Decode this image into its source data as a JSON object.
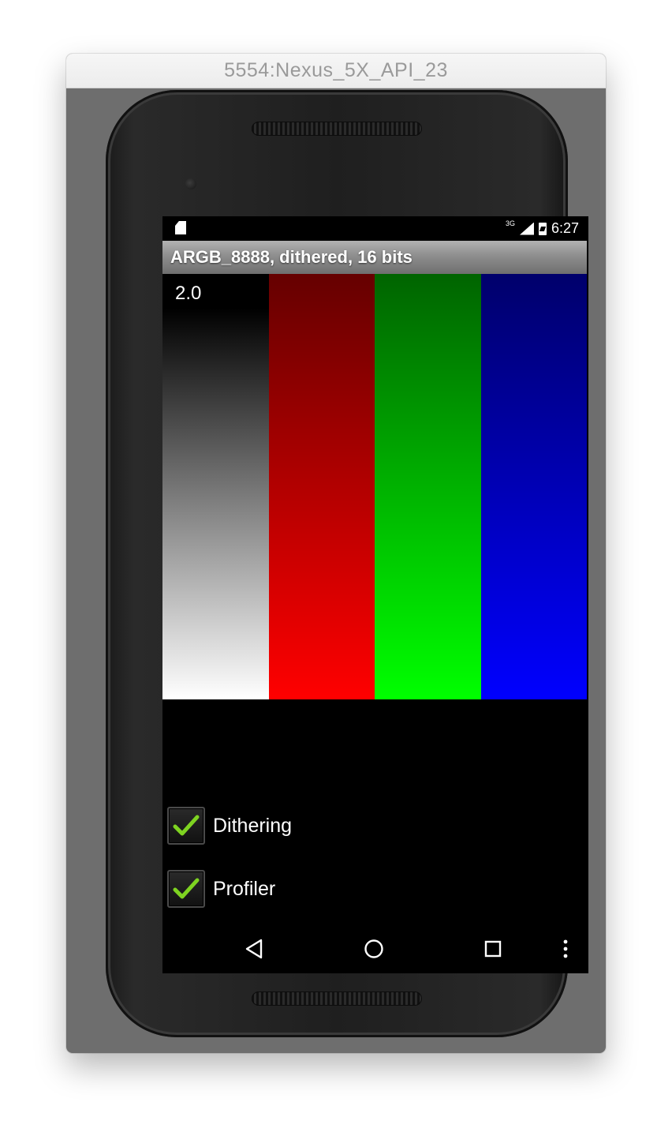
{
  "window": {
    "title": "5554:Nexus_5X_API_23"
  },
  "status_bar": {
    "network_type": "3G",
    "time": "6:27"
  },
  "action_bar": {
    "title": "ARGB_8888, dithered, 16 bits"
  },
  "content": {
    "profile_value": "2.0",
    "color_bars": [
      "white",
      "red",
      "green",
      "blue"
    ],
    "colors": {
      "white_end": "#ffffff",
      "red_end": "#ff0000",
      "green_end": "#00ff00",
      "blue_end": "#0000ff"
    }
  },
  "options": [
    {
      "label": "Dithering",
      "checked": true
    },
    {
      "label": "Profiler",
      "checked": true
    }
  ],
  "nav_bar": {
    "icons": [
      "back-icon",
      "home-icon",
      "recents-icon",
      "overflow-menu-icon"
    ]
  }
}
